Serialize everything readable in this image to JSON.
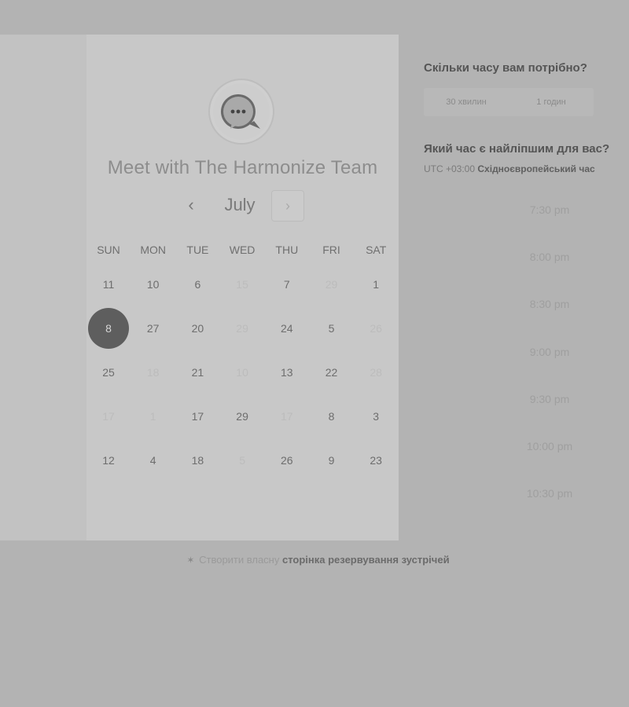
{
  "booking": {
    "title": "Meet with The Harmonize Team",
    "month": "July",
    "prev_icon": "‹",
    "next_icon": "›"
  },
  "calendar": {
    "weekdays": [
      "SUN",
      "MON",
      "TUE",
      "WED",
      "THU",
      "FRI",
      "SAT"
    ],
    "weeks": [
      [
        {
          "label": "11",
          "available": true
        },
        {
          "label": "10",
          "available": true
        },
        {
          "label": "6",
          "available": true
        },
        {
          "label": "15",
          "available": false
        },
        {
          "label": "7",
          "available": true
        },
        {
          "label": "29",
          "available": false
        },
        {
          "label": "1",
          "available": true
        }
      ],
      [
        {
          "label": "8",
          "available": true,
          "selected": true
        },
        {
          "label": "27",
          "available": true
        },
        {
          "label": "20",
          "available": true
        },
        {
          "label": "29",
          "available": false
        },
        {
          "label": "24",
          "available": true
        },
        {
          "label": "5",
          "available": true
        },
        {
          "label": "26",
          "available": false
        }
      ],
      [
        {
          "label": "25",
          "available": true
        },
        {
          "label": "18",
          "available": false
        },
        {
          "label": "21",
          "available": true
        },
        {
          "label": "10",
          "available": false
        },
        {
          "label": "13",
          "available": true
        },
        {
          "label": "22",
          "available": true
        },
        {
          "label": "28",
          "available": false
        }
      ],
      [
        {
          "label": "17",
          "available": false
        },
        {
          "label": "1",
          "available": false
        },
        {
          "label": "17",
          "available": true
        },
        {
          "label": "29",
          "available": true
        },
        {
          "label": "17",
          "available": false
        },
        {
          "label": "8",
          "available": true
        },
        {
          "label": "3",
          "available": true
        }
      ],
      [
        {
          "label": "12",
          "available": true
        },
        {
          "label": "4",
          "available": true
        },
        {
          "label": "18",
          "available": true
        },
        {
          "label": "5",
          "available": false
        },
        {
          "label": "26",
          "available": true
        },
        {
          "label": "9",
          "available": true
        },
        {
          "label": "23",
          "available": true
        }
      ]
    ]
  },
  "scheduler": {
    "duration_question": "Скільки часу вам потрібно?",
    "durations": [
      "30 хвилин",
      "1 годин"
    ],
    "time_question": "Який час є найліпшим для вас?",
    "timezone_offset": "UTC +03:00",
    "timezone_name": "Східноєвропейський час",
    "slots": [
      "7:30 pm",
      "8:00 pm",
      "8:30 pm",
      "9:00 pm",
      "9:30 pm",
      "10:00 pm",
      "10:30 pm"
    ]
  },
  "footer": {
    "prefix": "Створити власну",
    "link": "сторінка резервування зустрічей"
  },
  "colors": {
    "background": "#b3b3b3",
    "card": "#c8c8c8",
    "selected_day": "#5e5e5e"
  }
}
